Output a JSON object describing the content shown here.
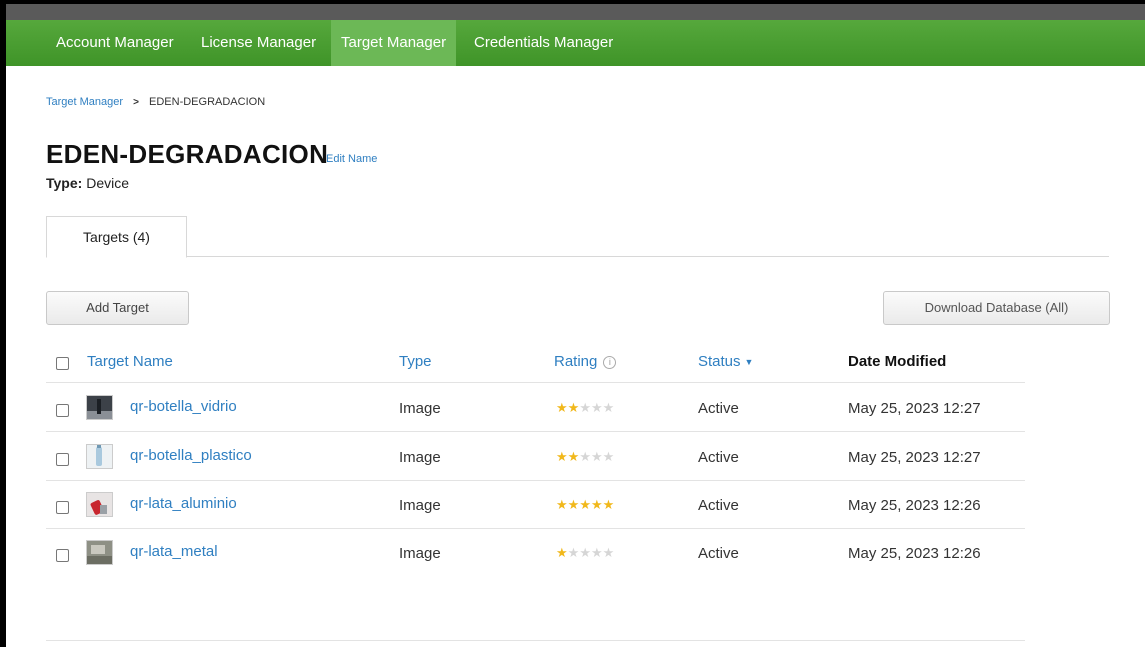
{
  "nav": {
    "items": [
      {
        "label": "Account Manager",
        "active": false
      },
      {
        "label": "License Manager",
        "active": false
      },
      {
        "label": "Target Manager",
        "active": true
      },
      {
        "label": "Credentials Manager",
        "active": false
      }
    ]
  },
  "breadcrumb": {
    "root": "Target Manager",
    "separator": ">",
    "current": "EDEN-DEGRADACION"
  },
  "header": {
    "title": "EDEN-DEGRADACION",
    "edit_label": "Edit Name",
    "type_label": "Type:",
    "type_value": "Device"
  },
  "tabs": [
    {
      "label": "Targets (4)",
      "active": true
    }
  ],
  "toolbar": {
    "add_label": "Add Target",
    "download_label": "Download Database (All)"
  },
  "table": {
    "columns": {
      "name": "Target Name",
      "type": "Type",
      "rating": "Rating",
      "status": "Status",
      "date": "Date Modified"
    },
    "rows": [
      {
        "name": "qr-botella_vidrio",
        "type": "Image",
        "rating": 2,
        "status": "Active",
        "date": "May 25, 2023 12:27",
        "thumb": "glass-bottle"
      },
      {
        "name": "qr-botella_plastico",
        "type": "Image",
        "rating": 2,
        "status": "Active",
        "date": "May 25, 2023 12:27",
        "thumb": "plastic-bottle"
      },
      {
        "name": "qr-lata_aluminio",
        "type": "Image",
        "rating": 5,
        "status": "Active",
        "date": "May 25, 2023 12:26",
        "thumb": "aluminum-can"
      },
      {
        "name": "qr-lata_metal",
        "type": "Image",
        "rating": 1,
        "status": "Active",
        "date": "May 25, 2023 12:26",
        "thumb": "metal-can"
      }
    ]
  },
  "colors": {
    "nav_bg": "#4a9e32",
    "nav_active": "#6cb856",
    "link": "#2f7fc1",
    "star_on": "#f1b81b",
    "star_off": "#d6d6d6"
  }
}
